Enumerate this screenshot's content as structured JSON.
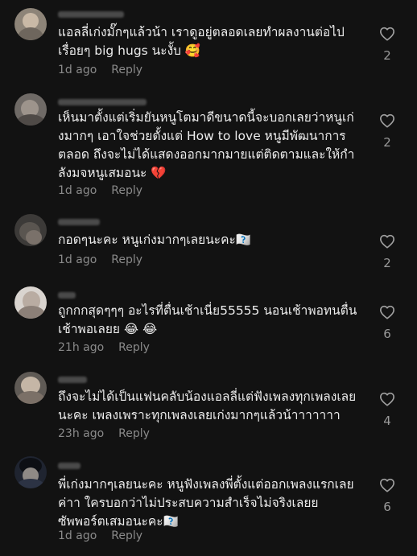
{
  "comments": [
    {
      "text": "แอลลี่เก่งมั๊กๆแล้วน้า เราดูอยู่ตลอดเลยทำผลงานต่อไปเรื่อยๆ big hugs นะงั้บ 🥰",
      "time": "1d ago",
      "reply": "Reply",
      "likes": "2"
    },
    {
      "text": "เห็นมาตั้งแต่เริ่มยันหนูโตมาดีขนาดนี้จะบอกเลยว่าหนูเก่งมากๆ เอาใจช่วยตั้งแต่ How to love หนูมีพัฒนาการตลอด ถึงจะไม่ได้แสดงออกมากมายแต่ติดตามและให้กำลังมจหนูเสมอนะ 💔",
      "time": "1d ago",
      "reply": "Reply",
      "likes": "2"
    },
    {
      "text": "กอดๆนะคะ หนูเก่งมากๆเลยนะคะ🇽🇽",
      "time": "1d ago",
      "reply": "Reply",
      "likes": "2"
    },
    {
      "text": "ถูกกกสุดๆๆๆ อะไรที่ตื่นเช้าเนี่ย55555 นอนเช้าพอทนตื่นเช้าพอเลยย 😂 😂",
      "time": "21h ago",
      "reply": "Reply",
      "likes": "6"
    },
    {
      "text": "ถึงจะไม่ได้เป็นแฟนคลับน้องแอลลี่แต่ฟังเพลงทุกเพลงเลยนะคะ เพลงเพราะทุกเพลงเลยเก่งมากๆแล้วน้าาาาาาา",
      "time": "23h ago",
      "reply": "Reply",
      "likes": "4"
    },
    {
      "text": "พี่เก่งมากๆเลยนะคะ หนูฟังเพลงพี่ตั้งแต่ออกเพลงแรกเลยค่าา ใครบอกว่าไม่ประสบความสำเร็จไม่จริงเลยย ซัพพอร์ตเสมอนะคะ🇽🇽",
      "time": "1d ago",
      "reply": "Reply",
      "likes": "6"
    }
  ],
  "icons": {
    "like": "heart-outline-icon"
  },
  "colors": {
    "background": "#121212",
    "text": "#ededed",
    "meta": "#8a8a8a"
  }
}
